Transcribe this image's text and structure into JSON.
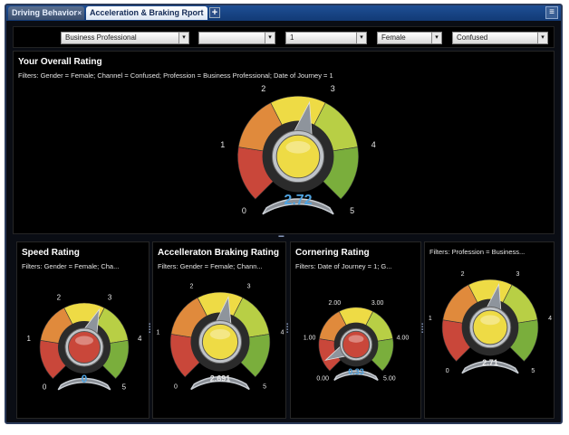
{
  "tabs": [
    {
      "label": "Driving Behavior",
      "close": "×",
      "active": false
    },
    {
      "label": "Acceleration & Braking Rport",
      "active": true
    }
  ],
  "tab_add_label": "+",
  "filters": {
    "profession": "Business Professional",
    "blank": "",
    "date_of_journey": "1",
    "gender": "Female",
    "channel": "Confused"
  },
  "dropdown_arrow": "▾",
  "overall": {
    "title": "Your Overall Rating",
    "filter_text": "Filters:  Gender = Female; Channel = Confused; Profession = Business Professional; Date of Journey = 1",
    "value": 2.72,
    "value_label": "2.72",
    "ticks": [
      "0",
      "1",
      "2",
      "3",
      "4",
      "5"
    ],
    "value_color": "#4fa3e0"
  },
  "panels": [
    {
      "key": "speed",
      "title": "Speed Rating",
      "filter_text": "Filters:  Gender = Female; Cha...",
      "value": 2.9,
      "value_label": "0",
      "value_color": "#4fa3e0",
      "center": "red",
      "ticks": [
        "0",
        "1",
        "2",
        "3",
        "4",
        "5"
      ]
    },
    {
      "key": "accel",
      "title": "Accelleraton Braking Rating",
      "filter_text": "Filters:  Gender = Female; Chann...",
      "value": 2.691,
      "value_label": "2.691",
      "value_color": "#e8e8e8",
      "center": "yellow",
      "ticks": [
        "0",
        "1",
        "2",
        "3",
        "4",
        "5"
      ]
    },
    {
      "key": "corner",
      "title": "Cornering Rating",
      "filter_text": "Filters:  Date of Journey = 1; G...",
      "value": 0.33,
      "value_label": "0.33",
      "value_color": "#4fa3e0",
      "center": "red",
      "ticks": [
        "0.00",
        "1.00",
        "2.00",
        "3.00",
        "4.00",
        "5.00"
      ]
    },
    {
      "key": "prof",
      "title": "",
      "filter_text": "Filters:  Profession = Business...",
      "value": 2.71,
      "value_label": "2.71",
      "value_color": "#e8e8e8",
      "center": "yellow",
      "ticks": [
        "0",
        "1",
        "2",
        "3",
        "4",
        "5"
      ]
    }
  ],
  "colors": {
    "red": "#c9473a",
    "orange": "#e08a3c",
    "yellow": "#eedb45",
    "yellowgreen": "#b8cf45",
    "green": "#7aae3c"
  }
}
